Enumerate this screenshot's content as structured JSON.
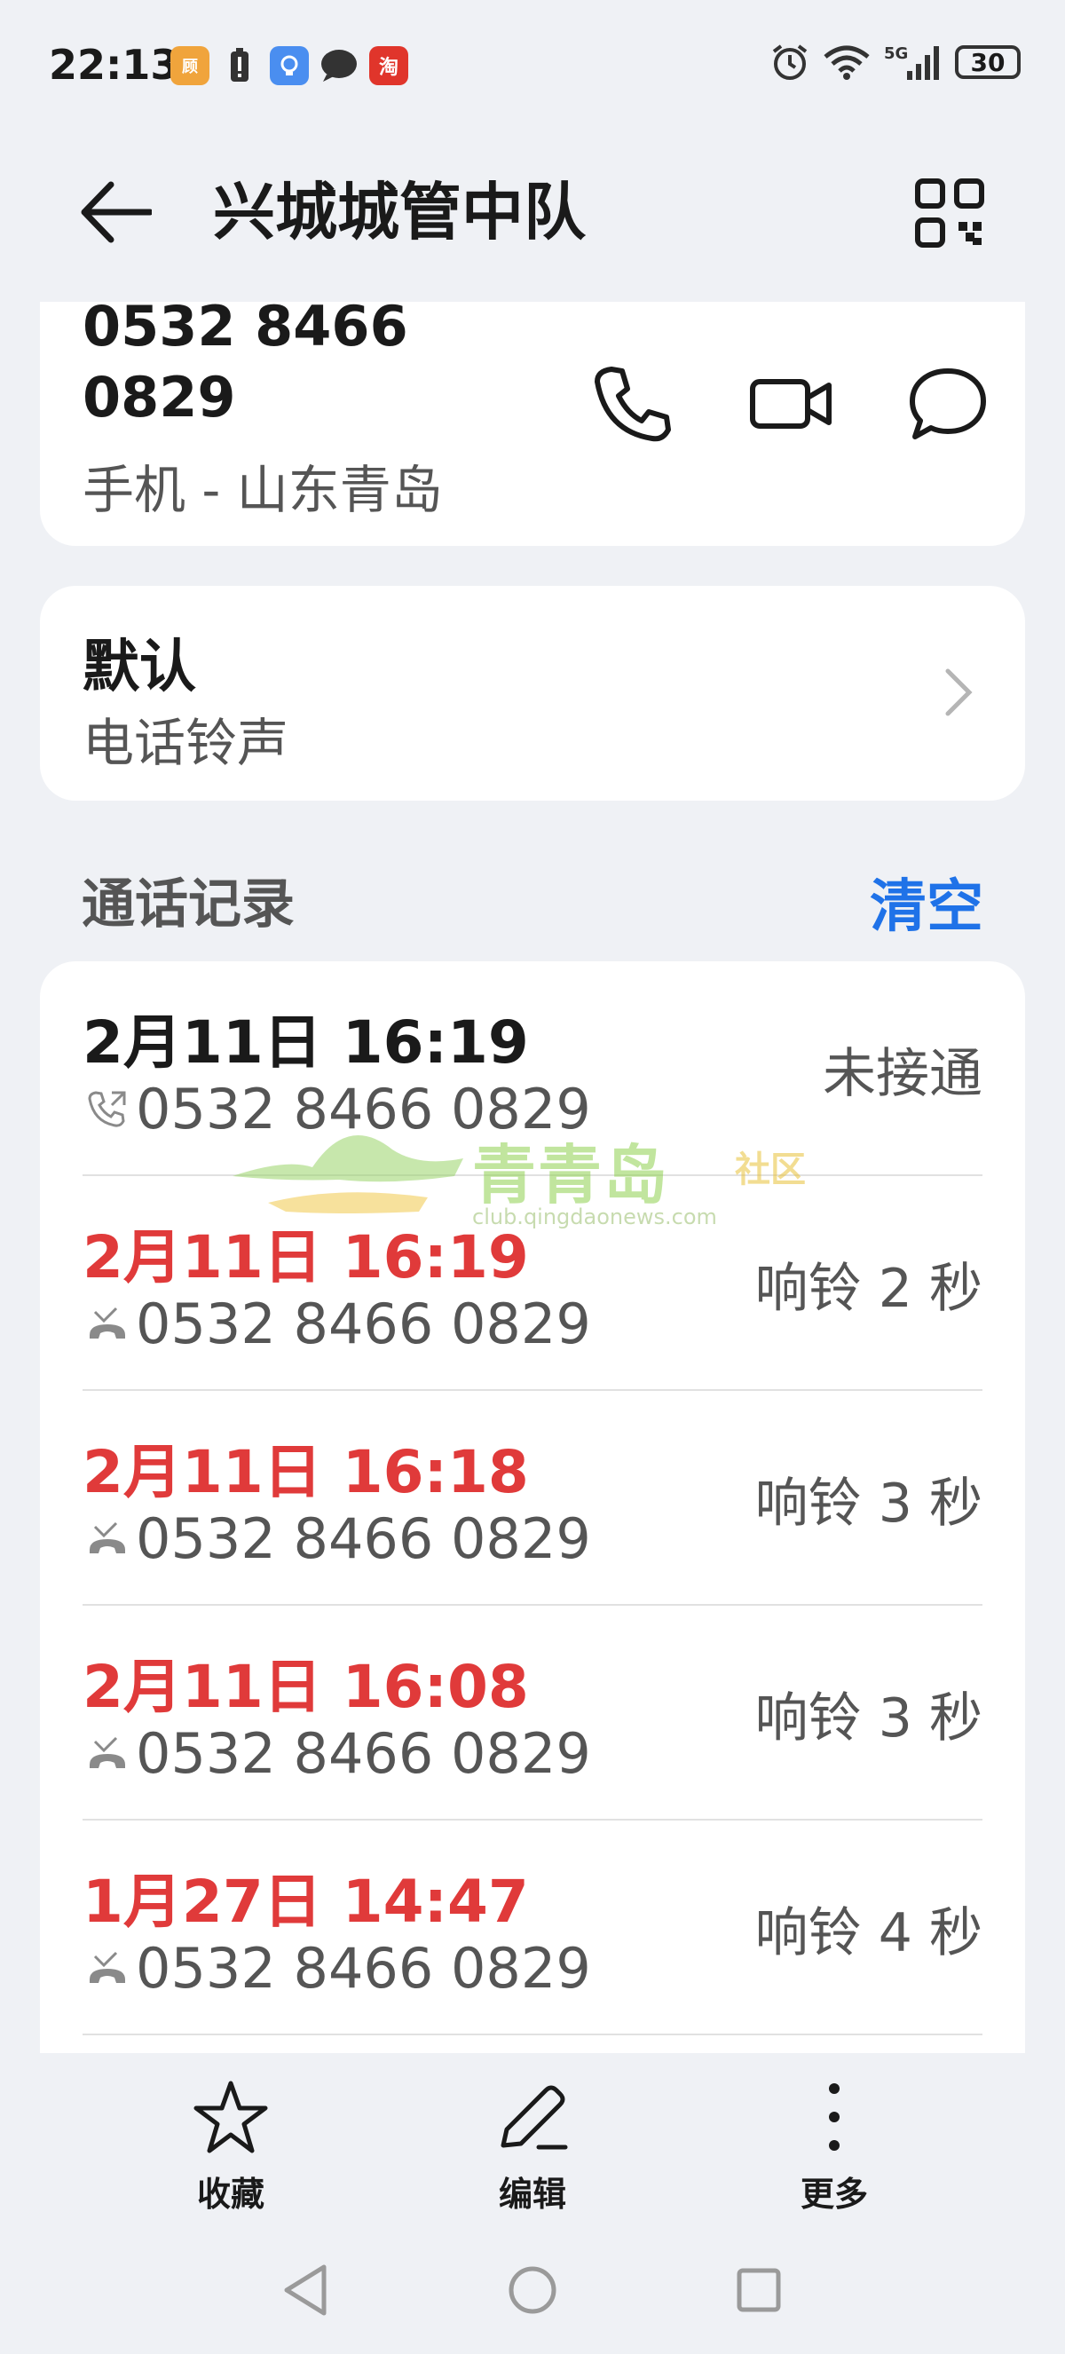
{
  "status_bar": {
    "time": "22:13",
    "app_badges": [
      {
        "name": "hospital-app-icon",
        "color": "#f0a43c",
        "text": "顾"
      },
      {
        "name": "battery-alert-icon",
        "color": "#333333",
        "text": "!"
      },
      {
        "name": "bulb-app-icon",
        "color": "#4a8ef0",
        "text": "◉"
      },
      {
        "name": "message-app-icon",
        "color": "#333333",
        "text": "●"
      },
      {
        "name": "taobao-app-icon",
        "color": "#e0352b",
        "text": "淘"
      }
    ],
    "battery_level": "30"
  },
  "header": {
    "title": "兴城城管中队"
  },
  "contact": {
    "number_line1": "0532 8466",
    "number_line2": "0829",
    "number_type": "手机 - 山东青岛"
  },
  "ringtone": {
    "name": "默认",
    "label": "电话铃声"
  },
  "call_log": {
    "header": "通话记录",
    "clear_label": "清空",
    "entries": [
      {
        "time": "2月11日 16:19",
        "number": "0532 8466 0829",
        "status": "未接通",
        "missed": false
      },
      {
        "time": "2月11日 16:19",
        "number": "0532 8466 0829",
        "status": "响铃 2 秒",
        "missed": true
      },
      {
        "time": "2月11日 16:18",
        "number": "0532 8466 0829",
        "status": "响铃 3 秒",
        "missed": true
      },
      {
        "time": "2月11日 16:08",
        "number": "0532 8466 0829",
        "status": "响铃 3 秒",
        "missed": true
      },
      {
        "time": "1月27日 14:47",
        "number": "0532 8466 0829",
        "status": "响铃 4 秒",
        "missed": true
      }
    ]
  },
  "watermark": {
    "title": "青青岛",
    "sub": "社区",
    "url": "club.qingdaonews.com"
  },
  "bottom_actions": {
    "favorite": "收藏",
    "edit": "编辑",
    "more": "更多"
  },
  "colors": {
    "accent": "#1f72e8",
    "missed": "#e03a3a",
    "background": "#eff1f5"
  }
}
